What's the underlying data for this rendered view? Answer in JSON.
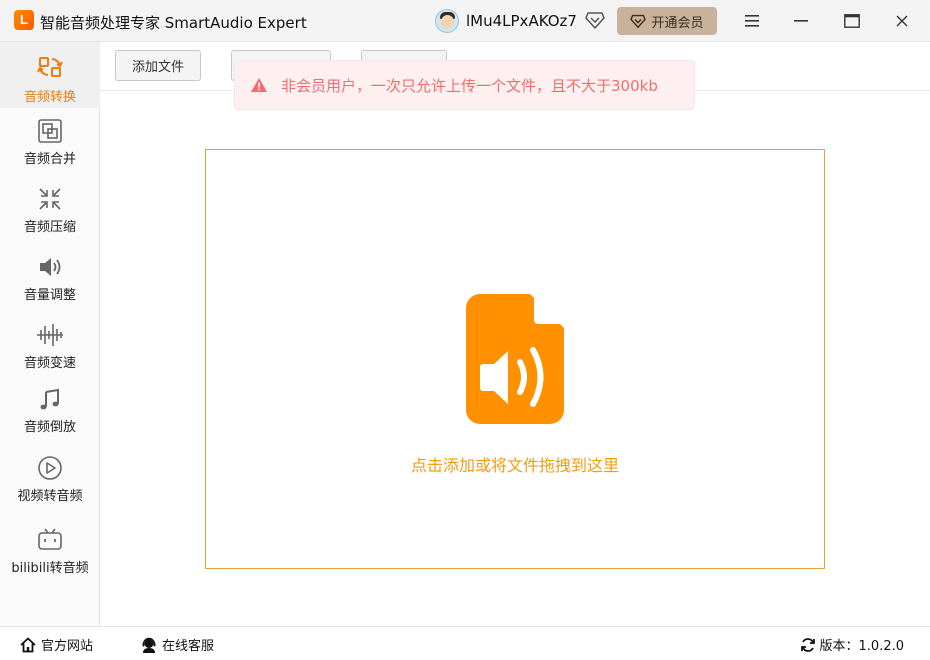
{
  "app": {
    "logo_char": "L",
    "title": "智能音频处理专家 SmartAudio Expert",
    "username": "lMu4LPxAKOz7",
    "vip_label": "开通会员"
  },
  "sidebar": {
    "items": [
      {
        "label": "音频转换",
        "icon": "convert-icon",
        "active": true
      },
      {
        "label": "音频合并",
        "icon": "merge-icon",
        "active": false
      },
      {
        "label": "音频压缩",
        "icon": "compress-icon",
        "active": false
      },
      {
        "label": "音量调整",
        "icon": "volume-icon",
        "active": false
      },
      {
        "label": "音频变速",
        "icon": "waveform-icon",
        "active": false
      },
      {
        "label": "音频倒放",
        "icon": "music-note-icon",
        "active": false
      },
      {
        "label": "视频转音频",
        "icon": "play-icon",
        "active": false
      },
      {
        "label": "bilibili转音频",
        "icon": "bilibili-icon",
        "active": false
      }
    ]
  },
  "toolbar": {
    "add_file": "添加文件",
    "btn2": "",
    "btn3": ""
  },
  "toast": {
    "message": "非会员用户，一次只允许上传一个文件，且不大于300kb"
  },
  "dropzone": {
    "hint": "点击添加或将文件拖拽到这里"
  },
  "footer": {
    "website": "官方网站",
    "support": "在线客服",
    "version": "版本：1.0.2.0"
  },
  "colors": {
    "accent": "#f07b10",
    "drop_border": "#e6a23c",
    "warning": "#f56c6c"
  }
}
